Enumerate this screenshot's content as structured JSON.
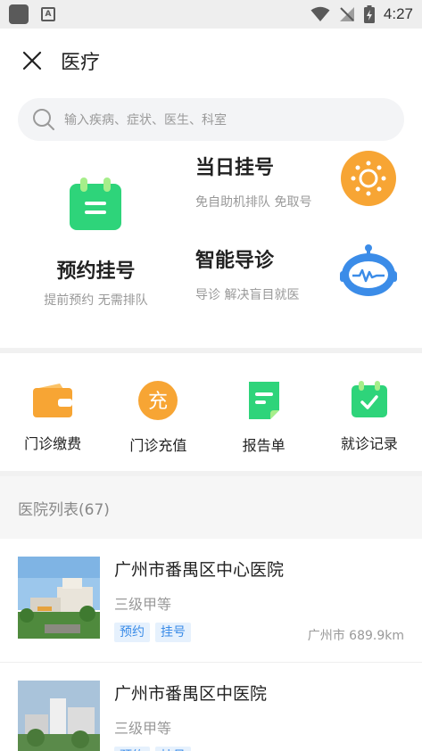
{
  "status_bar": {
    "time": "4:27"
  },
  "header": {
    "title": "医疗"
  },
  "search": {
    "placeholder": "输入疾病、症状、医生、科室"
  },
  "features": {
    "appointment": {
      "title": "预约挂号",
      "subtitle": "提前预约 无需排队"
    },
    "same_day": {
      "title": "当日挂号",
      "subtitle": "免自助机排队 免取号"
    },
    "smart_guide": {
      "title": "智能导诊",
      "subtitle": "导诊 解决盲目就医"
    }
  },
  "quick_actions": [
    {
      "label": "门诊缴费",
      "icon": "wallet-icon"
    },
    {
      "label": "门诊充值",
      "icon": "recharge-icon",
      "glyph": "充"
    },
    {
      "label": "报告单",
      "icon": "report-icon"
    },
    {
      "label": "就诊记录",
      "icon": "calendar-check-icon"
    }
  ],
  "hospital_list": {
    "header": "医院列表(67)",
    "items": [
      {
        "name": "广州市番禺区中心医院",
        "level": "三级甲等",
        "tags": [
          "预约",
          "挂号"
        ],
        "distance": "广州市 689.9km"
      },
      {
        "name": "广州市番禺区中医院",
        "level": "三级甲等",
        "tags": [
          "预约",
          "挂号"
        ],
        "distance": ""
      }
    ]
  },
  "colors": {
    "green": "#2ed47a",
    "orange": "#f7a534",
    "blue": "#3b8ce8",
    "tag_bg": "#e6f1fd"
  }
}
